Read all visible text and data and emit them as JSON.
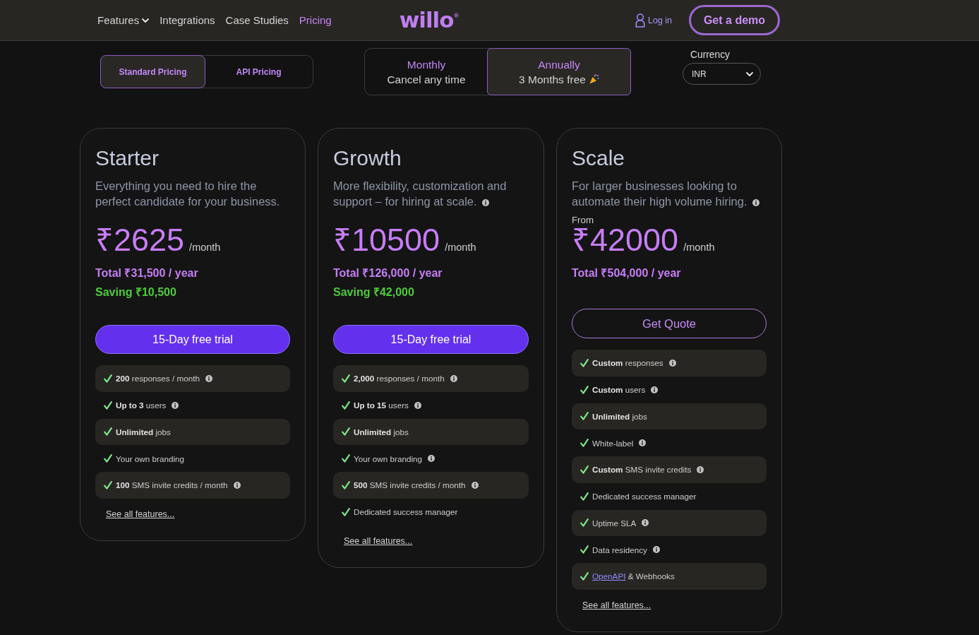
{
  "header": {
    "nav": [
      {
        "label": "Features",
        "dropdown": true,
        "selected": false
      },
      {
        "label": "Integrations",
        "dropdown": false,
        "selected": false
      },
      {
        "label": "Case Studies",
        "dropdown": false,
        "selected": false
      },
      {
        "label": "Pricing",
        "dropdown": false,
        "selected": true
      }
    ],
    "logo": "willo$^{®}$",
    "login": "Log in",
    "cta": "Get a demo"
  },
  "pricing_types": [
    {
      "label": "Standard Pricing",
      "selected": true
    },
    {
      "label": "API Pricing",
      "selected": false
    }
  ],
  "billing": [
    {
      "label": "Monthly",
      "note": "Cancel any time",
      "festive": false,
      "selected": false
    },
    {
      "label": "Annually",
      "note": "3 Months free",
      "festive": true,
      "selected": true
    }
  ],
  "currency": {
    "label": "Currency",
    "value": "INR"
  },
  "plans": [
    {
      "name": "Starter",
      "description": "Everything you need to hire the perfect candidate for your business.",
      "info": false,
      "price": "₹2625",
      "period": "/month",
      "total": "Total ₹31,500 / year",
      "saving": "Saving ₹10,500",
      "cta": {
        "label": "15-Day free trial",
        "kind": "filled"
      },
      "features": [
        {
          "text": "**200** responses / month",
          "info": true
        },
        {
          "text": "**Up to 3** users",
          "info": true
        },
        {
          "text": "**Unlimited** jobs",
          "info": false
        },
        {
          "text": "Your own branding",
          "info": false
        },
        {
          "text": "**100** SMS invite credits / month",
          "info": true
        }
      ],
      "more": "See all features..."
    },
    {
      "name": "Growth",
      "description": "More flexibility, customization and support – for hiring at scale.",
      "info": true,
      "price": "₹10500",
      "period": "/month",
      "total": "Total ₹126,000 / year",
      "saving": "Saving ₹42,000",
      "cta": {
        "label": "15-Day free trial",
        "kind": "filled"
      },
      "features": [
        {
          "text": "**2,000** responses / month",
          "info": true
        },
        {
          "text": "**Up to 15** users",
          "info": true
        },
        {
          "text": "**Unlimited** jobs",
          "info": false
        },
        {
          "text": "Your own branding",
          "info": true
        },
        {
          "text": "**500** SMS invite credits / month",
          "info": true
        },
        {
          "text": "Dedicated success manager",
          "info": false
        }
      ],
      "more": "See all features..."
    },
    {
      "name": "Scale",
      "description": "For larger businesses looking to automate their high volume hiring.",
      "info": true,
      "price_prefix": "From",
      "price": "₹42000",
      "period": "/month",
      "total": "Total ₹504,000 / year",
      "cta": {
        "label": "Get Quote",
        "kind": "outline"
      },
      "features": [
        {
          "text": "**Custom** responses",
          "info": true
        },
        {
          "text": "**Custom** users",
          "info": true
        },
        {
          "text": "**Unlimited** jobs",
          "info": false
        },
        {
          "text": "White-label",
          "info": true
        },
        {
          "text": "**Custom** SMS invite credits",
          "info": true
        },
        {
          "text": "Dedicated success manager",
          "info": false
        },
        {
          "text": "Uptime SLA",
          "info": true
        },
        {
          "text": "Data residency",
          "info": true
        },
        {
          "link": "OpenAPI",
          "text": "& Webhooks",
          "info": false
        }
      ],
      "more": "See all features..."
    }
  ]
}
